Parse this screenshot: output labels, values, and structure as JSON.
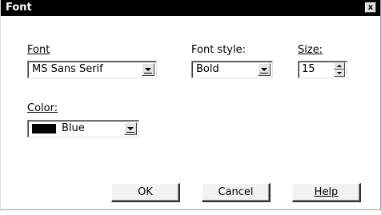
{
  "window": {
    "title": "Font",
    "close_label": "x"
  },
  "font": {
    "label": "Font",
    "value": "MS Sans Serif"
  },
  "font_style": {
    "label": "Font style:",
    "value": "Bold"
  },
  "size": {
    "label": "Size:",
    "value": "15"
  },
  "color": {
    "label": "Color:",
    "value": "Blue",
    "swatch": "#000000"
  },
  "buttons": {
    "ok": "OK",
    "cancel": "Cancel",
    "help": "Help"
  }
}
